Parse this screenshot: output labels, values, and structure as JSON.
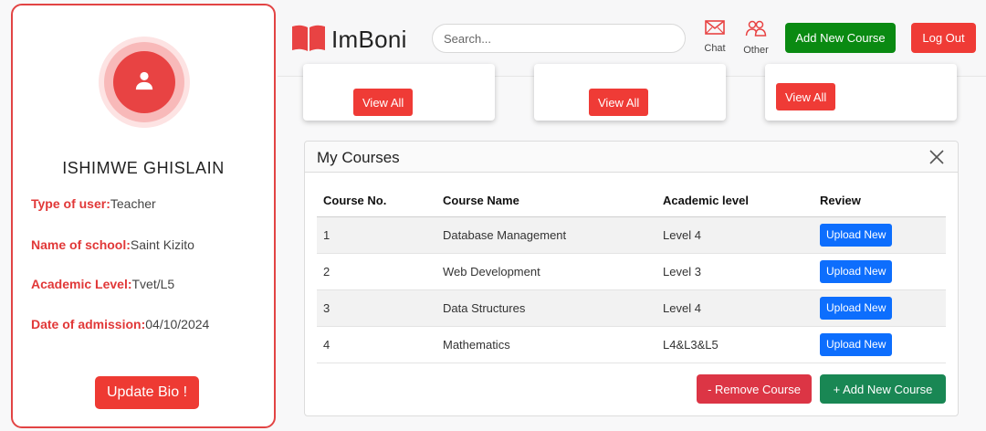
{
  "profile": {
    "name": "ISHIMWE GHISLAIN",
    "avatar_icon": "user-icon",
    "fields": [
      {
        "label": "Type of user:",
        "value": "Teacher"
      },
      {
        "label": "Name of school:",
        "value": "Saint Kizito"
      },
      {
        "label": "Academic Level:",
        "value": "Tvet/L5"
      },
      {
        "label": "Date of admission:",
        "value": "04/10/2024"
      }
    ],
    "update_bio_label": "Update Bio !"
  },
  "header": {
    "brand": "ImBoni",
    "brand_icon": "book-icon",
    "search_placeholder": "Search...",
    "chat_label": "Chat",
    "other_label": "Other",
    "add_course_label": "Add New Course",
    "logout_label": "Log Out"
  },
  "stat_cards": [
    {
      "button_label": "View All"
    },
    {
      "button_label": "View All"
    },
    {
      "button_label": "View All"
    }
  ],
  "courses": {
    "title": "My Courses",
    "columns": [
      "Course No.",
      "Course Name",
      "Academic level",
      "Review"
    ],
    "rows": [
      {
        "no": "1",
        "name": "Database Management",
        "level": "Level 4",
        "review": "Upload New"
      },
      {
        "no": "2",
        "name": "Web Development",
        "level": "Level 3",
        "review": "Upload New"
      },
      {
        "no": "3",
        "name": "Data Structures",
        "level": "Level 4",
        "review": "Upload New"
      },
      {
        "no": "4",
        "name": "Mathematics",
        "level": "L4&L3&L5",
        "review": "Upload New"
      }
    ],
    "remove_label": "- Remove Course",
    "add_label": "+ Add New Course"
  },
  "colors": {
    "accent_red": "#ef3b36",
    "green": "#0a8a12",
    "blue": "#0d6efd"
  }
}
